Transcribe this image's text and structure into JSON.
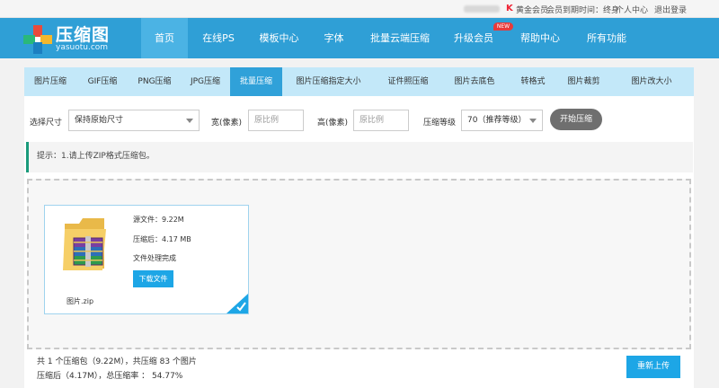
{
  "topbar": {
    "member_label": "黄金会员",
    "expiry_label": "会员到期时间：终身",
    "user_center": "个人中心",
    "logout": "退出登录"
  },
  "header": {
    "logo_title": "压缩图",
    "logo_sub": "yasuotu.com",
    "nav": [
      "首页",
      "在线PS",
      "模板中心",
      "字体",
      "批量云端压缩",
      "升级会员",
      "帮助中心",
      "所有功能"
    ],
    "new_badge": "NEW"
  },
  "tabs": [
    "图片压缩",
    "GIF压缩",
    "PNG压缩",
    "JPG压缩",
    "批量压缩",
    "图片压缩指定大小",
    "证件照压缩",
    "图片去底色",
    "转格式",
    "图片裁剪",
    "图片改大小"
  ],
  "form": {
    "size_label": "选择尺寸",
    "size_value": "保持原始尺寸",
    "width_label": "宽(像素)",
    "width_placeholder": "原比例",
    "height_label": "高(像素)",
    "height_placeholder": "原比例",
    "level_label": "压缩等级",
    "level_value": "70（推荐等级）",
    "start_button": "开始压缩"
  },
  "tip": "提示：1.请上传ZIP格式压缩包。",
  "result_card": {
    "source_size": "源文件：9.22M",
    "compressed_size": "压缩后：4.17 MB",
    "status": "文件处理完成",
    "download_button": "下载文件",
    "filename": "图片.zip"
  },
  "summary": {
    "line1": "共 1 个压缩包（9.22M），共压缩 83 个图片",
    "line2": "压缩后（4.17M），总压缩率 ： 54.77%"
  },
  "reupload_button": "重新上传",
  "colors": {
    "header_bg": "#2f9fd6",
    "tab_bar_bg": "#c3e8f9",
    "active_tab_bg": "#30a1d9",
    "accent_button": "#1da6e6",
    "tip_border": "#1a9b7b"
  }
}
